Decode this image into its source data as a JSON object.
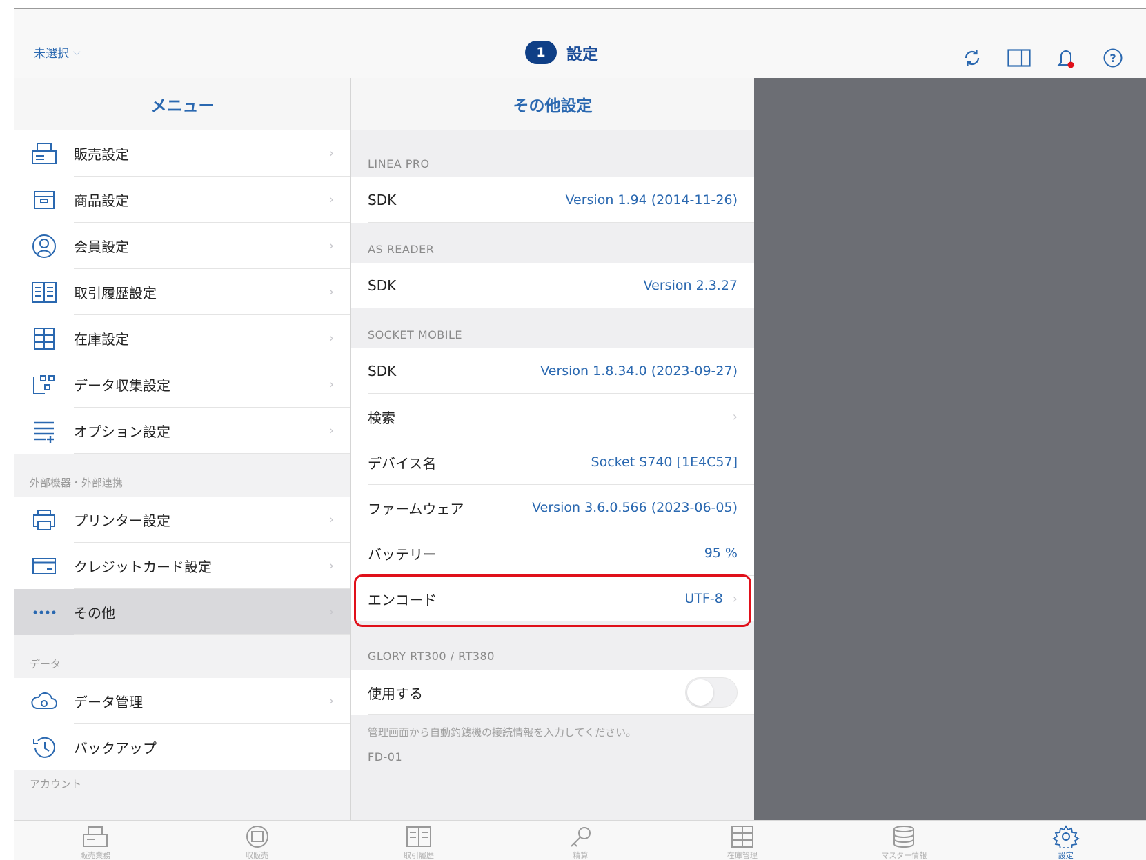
{
  "header": {
    "store_selector": "未選択",
    "badge_count": "1",
    "title": "設定"
  },
  "left": {
    "title": "メニュー",
    "group1": [
      {
        "label": "販売設定",
        "icon": "register-icon"
      },
      {
        "label": "商品設定",
        "icon": "box-icon"
      },
      {
        "label": "会員設定",
        "icon": "member-icon"
      },
      {
        "label": "取引履歴設定",
        "icon": "ledger-icon"
      },
      {
        "label": "在庫設定",
        "icon": "shelf-icon"
      },
      {
        "label": "データ収集設定",
        "icon": "hierarchy-icon"
      },
      {
        "label": "オプション設定",
        "icon": "list-plus-icon"
      }
    ],
    "section2": "外部機器・外部連携",
    "group2": [
      {
        "label": "プリンター設定",
        "icon": "printer-icon"
      },
      {
        "label": "クレジットカード設定",
        "icon": "card-icon"
      },
      {
        "label": "その他",
        "icon": "dots-icon"
      }
    ],
    "section3": "データ",
    "group3": [
      {
        "label": "データ管理",
        "icon": "cloud-icon"
      },
      {
        "label": "バックアップ",
        "icon": "history-icon"
      }
    ],
    "section4": "アカウント"
  },
  "mid": {
    "title": "その他設定",
    "linea_label": "LINEA PRO",
    "linea_sdk_label": "SDK",
    "linea_sdk_value": "Version 1.94 (2014-11-26)",
    "asreader_label": "AS READER",
    "asreader_sdk_label": "SDK",
    "asreader_sdk_value": "Version 2.3.27",
    "socket_label": "SOCKET MOBILE",
    "socket_sdk_label": "SDK",
    "socket_sdk_value": "Version 1.8.34.0 (2023-09-27)",
    "search_label": "検索",
    "device_label": "デバイス名",
    "device_value": "Socket S740 [1E4C57]",
    "firmware_label": "ファームウェア",
    "firmware_value": "Version 3.6.0.566 (2023-06-05)",
    "battery_label": "バッテリー",
    "battery_value": "95 %",
    "encode_label": "エンコード",
    "encode_value": "UTF-8",
    "glory_label": "GLORY RT300 / RT380",
    "use_label": "使用する",
    "hint": "管理画面から自動釣銭機の接続情報を入力してください。",
    "fd_label": "FD-01"
  },
  "tabs": [
    {
      "label": "販売業務",
      "icon": "register-icon"
    },
    {
      "label": "収販売",
      "icon": "receipt-icon"
    },
    {
      "label": "取引履歴",
      "icon": "ledger-icon"
    },
    {
      "label": "精算",
      "icon": "key-icon"
    },
    {
      "label": "在庫管理",
      "icon": "shelf-icon"
    },
    {
      "label": "マスター情報",
      "icon": "database-icon"
    },
    {
      "label": "設定",
      "icon": "gear-icon"
    }
  ],
  "colors": {
    "accent": "#2a68b0",
    "badge": "#0f3f86",
    "highlight": "#e0101a",
    "detail_bg": "#6c6e74"
  }
}
